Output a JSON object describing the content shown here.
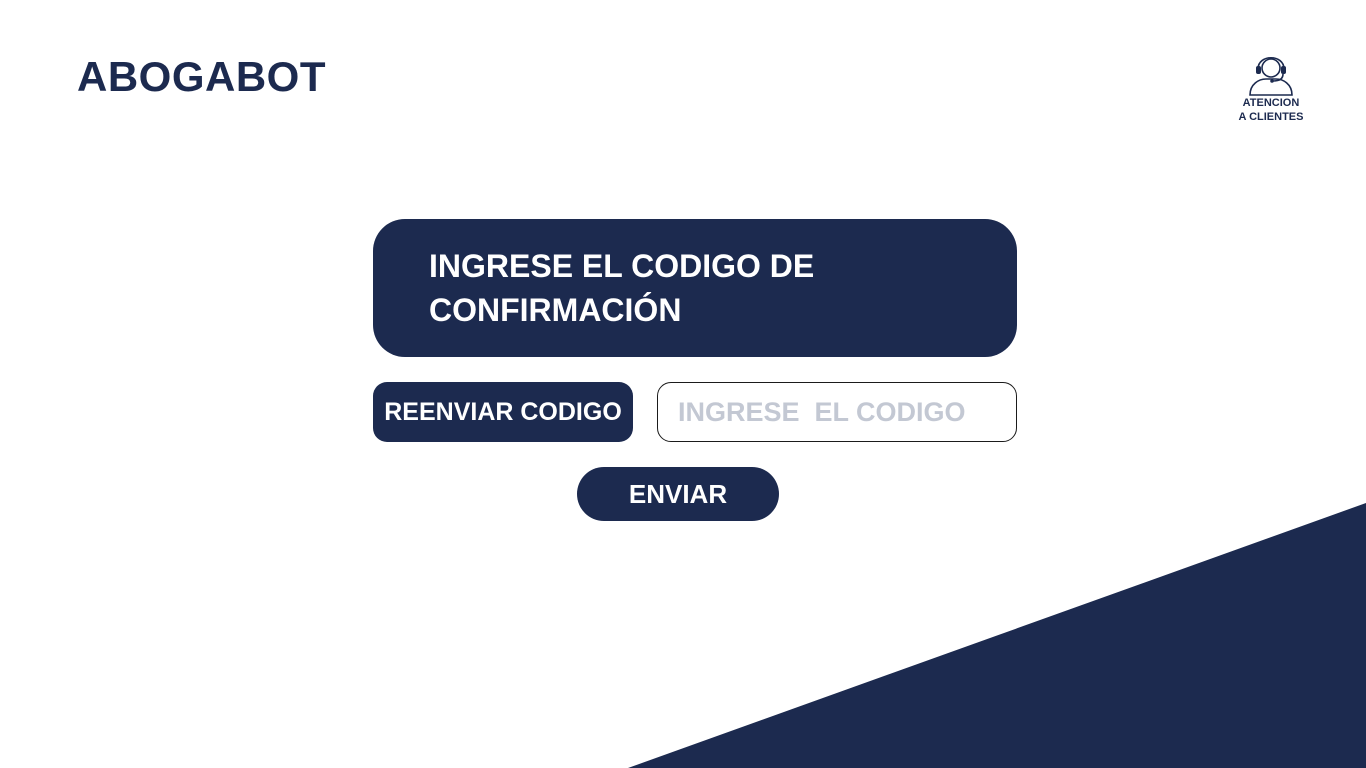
{
  "header": {
    "brand": "ABOGABOT",
    "support": {
      "icon": "headset-agent-icon",
      "line1": "ATENCION",
      "line2": "A CLIENTES"
    }
  },
  "main": {
    "prompt": {
      "line1": "INGRESE EL CODIGO DE",
      "line2": "CONFIRMACIÓN"
    },
    "resend_label": "REENVIAR CODIGO",
    "code_input": {
      "value": "",
      "placeholder": "INGRESE  EL CODIGO"
    },
    "send_label": "ENVIAR"
  },
  "colors": {
    "primary": "#1c2a4f",
    "background": "#ffffff",
    "placeholder": "#c3c8d3",
    "input_border": "#1b1b1b"
  }
}
